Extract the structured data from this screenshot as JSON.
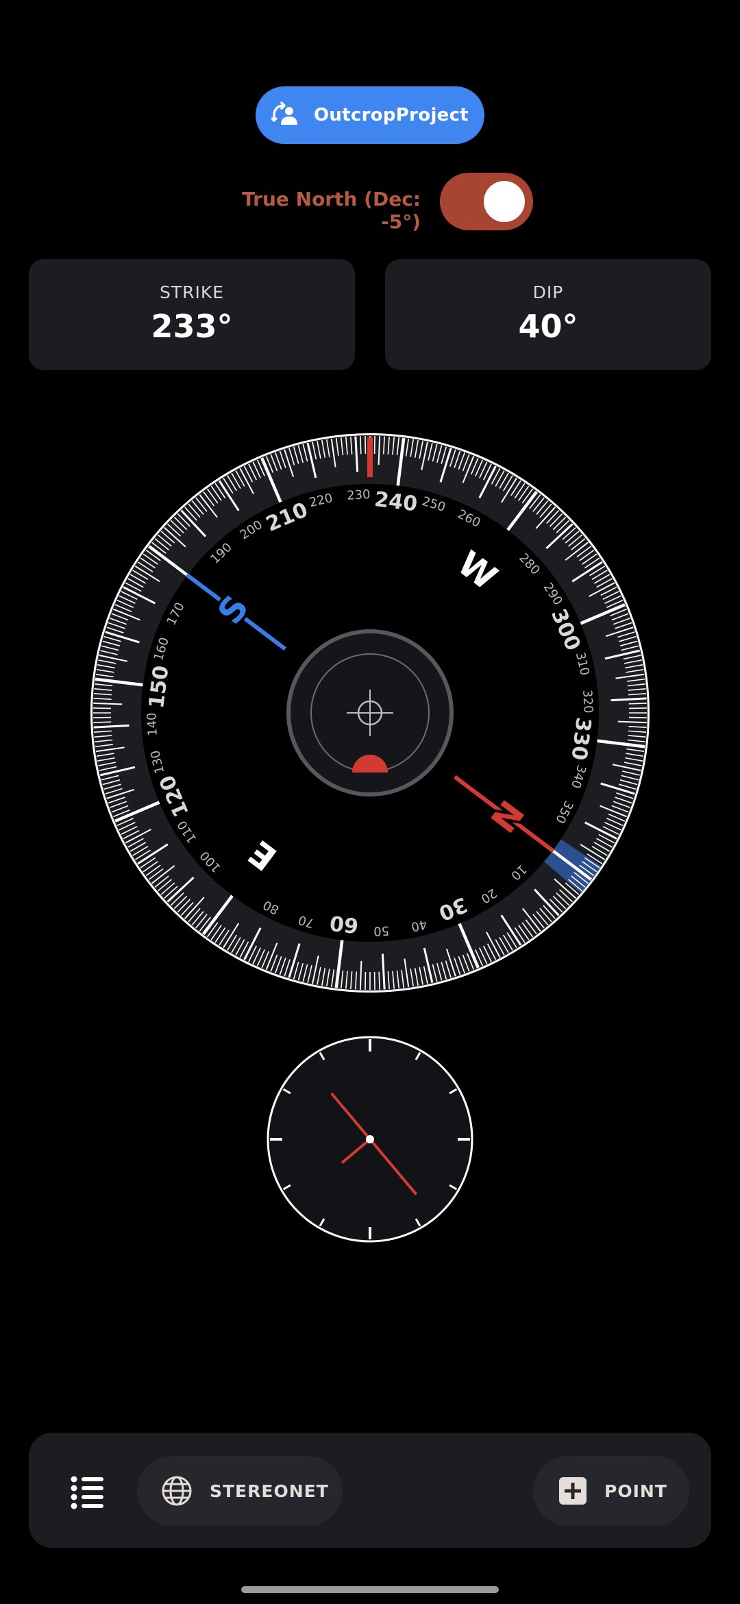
{
  "project": {
    "label": "OutcropProject",
    "icon": "project-switch-icon"
  },
  "north": {
    "label": "True North (Dec: -5°)",
    "enabled": true
  },
  "readouts": {
    "strike": {
      "caption": "STRIKE",
      "value": "233°"
    },
    "dip": {
      "caption": "DIP",
      "value": "40°"
    }
  },
  "compass": {
    "heading_deg": 233,
    "dip_deg": 40,
    "cardinals": {
      "N": "N",
      "S": "S",
      "E": "E",
      "W": "W"
    },
    "labels_small": [
      "10",
      "20",
      "40",
      "50",
      "70",
      "80",
      "100",
      "110",
      "130",
      "140",
      "160",
      "170",
      "190",
      "200",
      "220",
      "230",
      "250",
      "260",
      "280",
      "290",
      "310",
      "320",
      "340",
      "350"
    ],
    "labels_large": [
      "30",
      "60",
      "120",
      "150",
      "210",
      "240",
      "300",
      "330"
    ],
    "colors": {
      "north_needle": "#d43a34",
      "south_needle": "#3b7de8",
      "lubber": "#d43a34",
      "level_bubble": "#d43a34",
      "north_sector": "#2c4f8f"
    }
  },
  "clinometer": {
    "dip_deg": 40,
    "hand_color": "#d43a34"
  },
  "bottom": {
    "menu_icon": "list-icon",
    "stereonet": {
      "label": "STEREONET",
      "icon": "globe-icon"
    },
    "point": {
      "label": "POINT",
      "icon": "add-box-icon"
    }
  }
}
